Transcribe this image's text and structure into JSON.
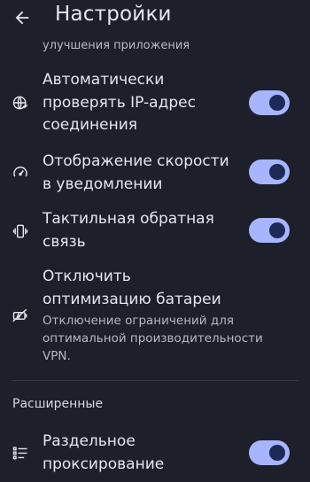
{
  "header": {
    "title": "Настройки"
  },
  "partial_item": {
    "subtitle": "улучшения приложения"
  },
  "items": [
    {
      "label": "Автоматически проверять IP-адрес соединения",
      "icon": "globe-check-icon",
      "toggle": "on"
    },
    {
      "label": "Отображение скорости в уведомлении",
      "icon": "speedometer-icon",
      "toggle": "on"
    },
    {
      "label": "Тактильная обратная связь",
      "icon": "vibration-icon",
      "toggle": "on"
    },
    {
      "label": "Отключить оптимизацию батареи",
      "subtitle": "Отключение ограничений для оптимальной производительности VPN.",
      "icon": "battery-saver-off-icon"
    }
  ],
  "section": {
    "title": "Расширенные"
  },
  "advanced_items": [
    {
      "label": "Раздельное проксирование",
      "icon": "split-list-icon",
      "toggle": "on"
    }
  ],
  "colors": {
    "background": "#1d1f2b",
    "toggle_track": "#a7b5ff",
    "toggle_knob": "#1d2a58"
  }
}
